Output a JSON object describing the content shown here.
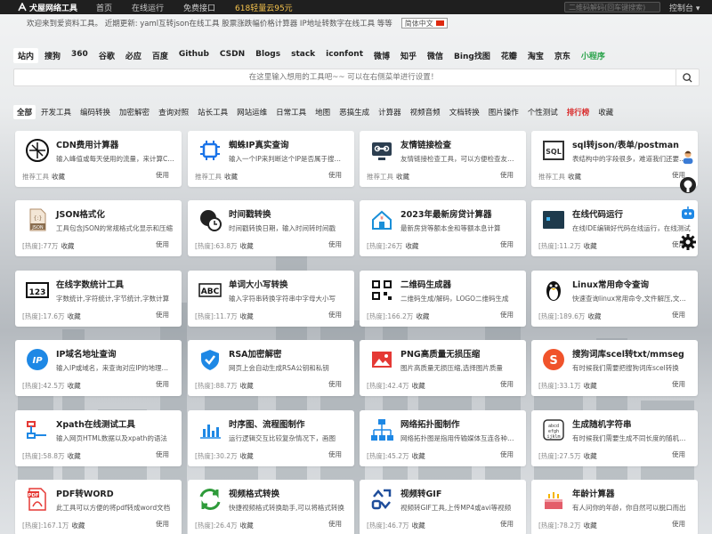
{
  "topbar": {
    "logo": "犬屋网络工具",
    "nav": [
      "首页",
      "在线运行",
      "免费接口"
    ],
    "promo": "618轻量云95元",
    "qr_placeholder": "二维码解码(回车键搜索)",
    "console": "控制台 ▾"
  },
  "notice": {
    "text": "欢迎来到爱资料工具。 近期更新: yaml互转json在线工具   股票涨跌幅价格计算器   IP地址转数字在线工具   等等",
    "lang": "简体中文"
  },
  "engines": [
    "站内",
    "搜狗",
    "360",
    "谷歌",
    "必应",
    "百度",
    "Github",
    "CSDN",
    "Blogs",
    "stack",
    "iconfont",
    "微博",
    "知乎",
    "微信",
    "Bing找图",
    "花瓣",
    "淘宝",
    "京东",
    "小程序"
  ],
  "search": {
    "placeholder": "在这里输入想用的工具吧~~ 可以在右侧菜单进行设置！"
  },
  "categories": [
    "全部",
    "开发工具",
    "编码转换",
    "加密解密",
    "查询对照",
    "站长工具",
    "网站运维",
    "日常工具",
    "地图",
    "恶搞生成",
    "计算器",
    "视频音频",
    "文档转换",
    "图片操作",
    "个性测试",
    "排行榜",
    "收藏"
  ],
  "cards": [
    {
      "title": "CDN费用计算器",
      "desc": "输入峰值或每天使用的流量，来计算CDN费用",
      "meta": "推荐工具",
      "fav": "收藏",
      "use": "使用",
      "icon": "cdn-icon"
    },
    {
      "title": "蜘蛛IP真实查询",
      "desc": "输入一个IP来判断这个IP是否属于搜索引擎蜘蛛",
      "meta": "推荐工具",
      "fav": "收藏",
      "use": "使用",
      "icon": "spider-chip-icon"
    },
    {
      "title": "友情链接检查",
      "desc": "友情链接检查工具，可以方便检查友情链接",
      "meta": "推荐工具",
      "fav": "收藏",
      "use": "使用",
      "icon": "link-check-icon"
    },
    {
      "title": "sql转json/表单/postman",
      "desc": "表结构中的字段很多，难道我们还要一个个写",
      "meta": "推荐工具",
      "fav": "收藏",
      "use": "使用",
      "icon": "sql-icon"
    },
    {
      "title": "JSON格式化",
      "desc": "工具包含JSON的常规格式化显示和压缩",
      "meta": "[热度]:77万",
      "fav": "收藏",
      "use": "使用",
      "icon": "json-file-icon"
    },
    {
      "title": "时间戳转换",
      "desc": "时间戳转换日期，输入时间转时间戳",
      "meta": "[热度]:63.8万",
      "fav": "收藏",
      "use": "使用",
      "icon": "timestamp-icon"
    },
    {
      "title": "2023年最新房贷计算器",
      "desc": "最新房贷等额本金和等额本息计算",
      "meta": "[热度]:26万",
      "fav": "收藏",
      "use": "使用",
      "icon": "house-loan-icon"
    },
    {
      "title": "在线代码运行",
      "desc": "在线IDE编辑好代码在线运行，在线测试",
      "meta": "[热度]:11.2万",
      "fav": "收藏",
      "use": "使用",
      "icon": "code-run-icon"
    },
    {
      "title": "在线字数统计工具",
      "desc": "字数统计,字符统计,字节统计,字数计算",
      "meta": "[热度]:17.6万",
      "fav": "收藏",
      "use": "使用",
      "icon": "count-123-icon"
    },
    {
      "title": "单词大小写转换",
      "desc": "输入字符串转换字符串中字母大小写",
      "meta": "[热度]:11.7万",
      "fav": "收藏",
      "use": "使用",
      "icon": "abc-icon"
    },
    {
      "title": "二维码生成器",
      "desc": "二维码生成/解码，LOGO二维码生成",
      "meta": "[热度]:166.2万",
      "fav": "收藏",
      "use": "使用",
      "icon": "qrcode-icon"
    },
    {
      "title": "Linux常用命令查询",
      "desc": "快速查询linux常用命令,文件解压,文件操作",
      "meta": "[热度]:189.6万",
      "fav": "收藏",
      "use": "使用",
      "icon": "linux-penguin-icon"
    },
    {
      "title": "IP域名地址查询",
      "desc": "输入IP或域名，来查询对应IP的地理位置",
      "meta": "[热度]:42.5万",
      "fav": "收藏",
      "use": "使用",
      "icon": "ip-icon"
    },
    {
      "title": "RSA加密解密",
      "desc": "网页上会自动生成RSA公钥和私钥",
      "meta": "[热度]:88.7万",
      "fav": "收藏",
      "use": "使用",
      "icon": "shield-check-icon"
    },
    {
      "title": "PNG高质量无损压缩",
      "desc": "图片高质量无损压缩,选择图片质量",
      "meta": "[热度]:42.4万",
      "fav": "收藏",
      "use": "使用",
      "icon": "image-icon"
    },
    {
      "title": "搜狗词库scel转txt/mmseg",
      "desc": "有时候我们需要把搜狗词库scel转换",
      "meta": "[热度]:33.1万",
      "fav": "收藏",
      "use": "使用",
      "icon": "sogou-icon"
    },
    {
      "title": "Xpath在线测试工具",
      "desc": "输入网页HTML数据以及xpath的语法",
      "meta": "[热度]:58.8万",
      "fav": "收藏",
      "use": "使用",
      "icon": "xpath-icon"
    },
    {
      "title": "时序图、流程图制作",
      "desc": "运行逻辑交互比较复杂情况下，画图",
      "meta": "[热度]:30.2万",
      "fav": "收藏",
      "use": "使用",
      "icon": "sequence-chart-icon"
    },
    {
      "title": "网络拓扑图制作",
      "desc": "网络拓扑图是指用传输媒体互连各种设备",
      "meta": "[热度]:45.2万",
      "fav": "收藏",
      "use": "使用",
      "icon": "topology-icon"
    },
    {
      "title": "生成随机字符串",
      "desc": "有时候我们需要生成不同长度的随机字符串",
      "meta": "[热度]:27.5万",
      "fav": "收藏",
      "use": "使用",
      "icon": "random-string-icon"
    },
    {
      "title": "PDF转WORD",
      "desc": "此工具可以方便的将pdf转成word文档",
      "meta": "[热度]:167.1万",
      "fav": "收藏",
      "use": "使用",
      "icon": "pdf-icon"
    },
    {
      "title": "视频格式转换",
      "desc": "快捷视频格式转换助手,可以将格式转换",
      "meta": "[热度]:26.4万",
      "fav": "收藏",
      "use": "使用",
      "icon": "convert-arrows-icon"
    },
    {
      "title": "视频转GIF",
      "desc": "视频转GIF工具,上传MP4或avi等视频",
      "meta": "[热度]:46.7万",
      "fav": "收藏",
      "use": "使用",
      "icon": "video-gif-icon"
    },
    {
      "title": "年龄计算器",
      "desc": "有人问你的年龄，你自然可以脱口而出",
      "meta": "[热度]:78.2万",
      "fav": "收藏",
      "use": "使用",
      "icon": "birthday-cake-icon"
    }
  ],
  "sidebar": [
    "user-avatar-icon",
    "github-icon",
    "robot-icon",
    "settings-gear-icon"
  ]
}
